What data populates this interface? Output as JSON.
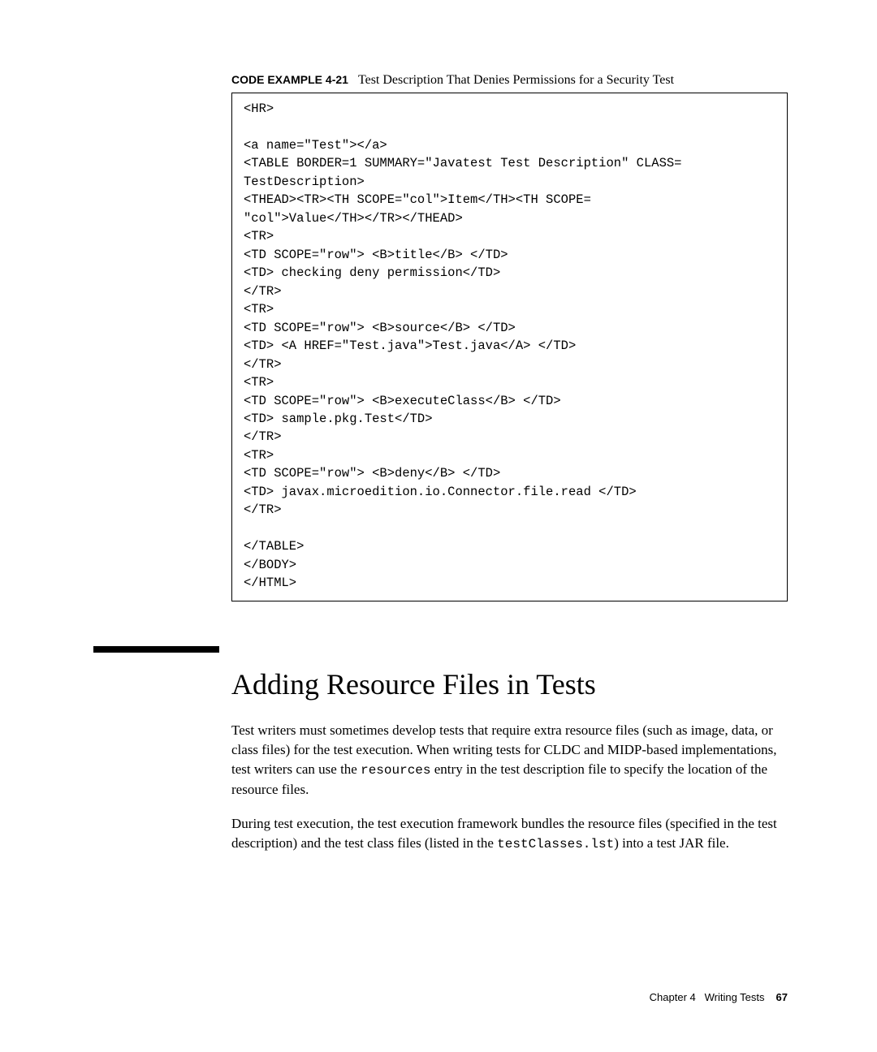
{
  "caption": {
    "label": "CODE EXAMPLE 4-21",
    "text": "Test Description That Denies Permissions for a Security Test"
  },
  "code": "<HR>\n\n<a name=\"Test\"></a>\n<TABLE BORDER=1 SUMMARY=\"Javatest Test Description\" CLASS=\nTestDescription>\n<THEAD><TR><TH SCOPE=\"col\">Item</TH><TH SCOPE=\n\"col\">Value</TH></TR></THEAD>\n<TR>\n<TD SCOPE=\"row\"> <B>title</B> </TD>\n<TD> checking deny permission</TD>\n</TR>\n<TR>\n<TD SCOPE=\"row\"> <B>source</B> </TD>\n<TD> <A HREF=\"Test.java\">Test.java</A> </TD>\n</TR>\n<TR>\n<TD SCOPE=\"row\"> <B>executeClass</B> </TD>\n<TD> sample.pkg.Test</TD>\n</TR>\n<TR>\n<TD SCOPE=\"row\"> <B>deny</B> </TD>\n<TD> javax.microedition.io.Connector.file.read </TD>\n</TR>\n\n</TABLE>\n</BODY>\n</HTML>",
  "heading": "Adding Resource Files in Tests",
  "para1": {
    "t1": "Test writers must sometimes develop tests that require extra resource files (such as image, data, or class files) for the test execution. When writing tests for CLDC and MIDP-based implementations, test writers can use the ",
    "code1": "resources",
    "t2": " entry in the test description file to specify the location of the resource files."
  },
  "para2": {
    "t1": "During test execution, the test execution framework bundles the resource files (specified in the test description) and the test class files (listed in the ",
    "code1": "testClasses.lst",
    "t2": ") into a test JAR file."
  },
  "footer": {
    "chapter": "Chapter 4",
    "title": "Writing Tests",
    "page": "67"
  }
}
